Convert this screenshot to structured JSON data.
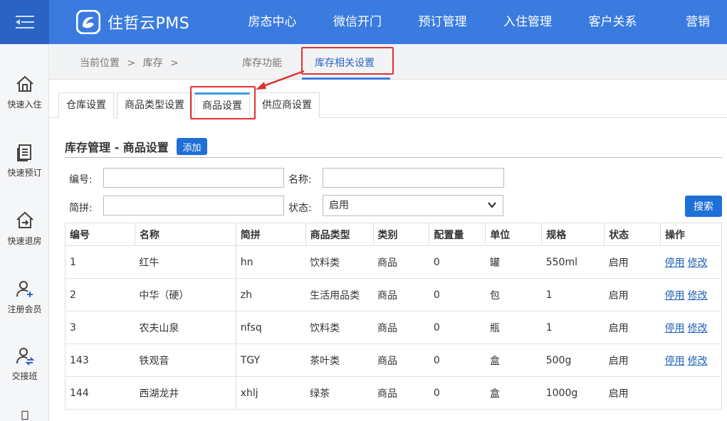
{
  "brand": {
    "name": "住哲云PMS"
  },
  "nav": [
    "房态中心",
    "微信开门",
    "预订管理",
    "入住管理",
    "客户关系",
    "营销"
  ],
  "sidebar": [
    "快速入住",
    "快速预订",
    "快速退房",
    "注册会员",
    "交接班"
  ],
  "breadcrumb": {
    "current": "当前位置",
    "sep1": ">",
    "section": "库存",
    "sep2": ">"
  },
  "func_tabs": {
    "functions": "库存功能",
    "settings": "库存相关设置"
  },
  "sub_tabs": [
    "仓库设置",
    "商品类型设置",
    "商品设置",
    "供应商设置"
  ],
  "content": {
    "title": "库存管理 - 商品设置",
    "add_label": "添加",
    "search_label": "搜索"
  },
  "filters": {
    "code_label": "编号:",
    "name_label": "名称:",
    "pinyin_label": "简拼:",
    "status_label": "状态:",
    "status_value": "启用"
  },
  "table": {
    "headers": [
      "编号",
      "名称",
      "简拼",
      "商品类型",
      "类别",
      "配置量",
      "单位",
      "规格",
      "状态",
      "操作"
    ],
    "rows": [
      {
        "code": "1",
        "name": "红牛",
        "pinyin": "hn",
        "type": "饮料类",
        "category": "商品",
        "qty": "0",
        "unit": "罐",
        "spec": "550ml",
        "status": "启用",
        "act1": "停用",
        "act2": "修改"
      },
      {
        "code": "2",
        "name": "中华（硬）",
        "pinyin": "zh",
        "type": "生活用品类",
        "category": "商品",
        "qty": "0",
        "unit": "包",
        "spec": "1",
        "status": "启用",
        "act1": "停用",
        "act2": "修改"
      },
      {
        "code": "3",
        "name": "农夫山泉",
        "pinyin": "nfsq",
        "type": "饮料类",
        "category": "商品",
        "qty": "0",
        "unit": "瓶",
        "spec": "1",
        "status": "启用",
        "act1": "停用",
        "act2": "修改"
      },
      {
        "code": "143",
        "name": "铁观音",
        "pinyin": "TGY",
        "type": "茶叶类",
        "category": "商品",
        "qty": "0",
        "unit": "盒",
        "spec": "500g",
        "status": "启用",
        "act1": "停用",
        "act2": "修改"
      },
      {
        "code": "144",
        "name": "西湖龙井",
        "pinyin": "xhlj",
        "type": "绿茶",
        "category": "商品",
        "qty": "0",
        "unit": "盒",
        "spec": "1000g",
        "status": "启用",
        "act1": "",
        "act2": ""
      }
    ]
  },
  "colors": {
    "topbar": "#3b7be0",
    "toggle": "#2b63c4",
    "button": "#1e6fd6",
    "highlight": "#e0322d"
  }
}
